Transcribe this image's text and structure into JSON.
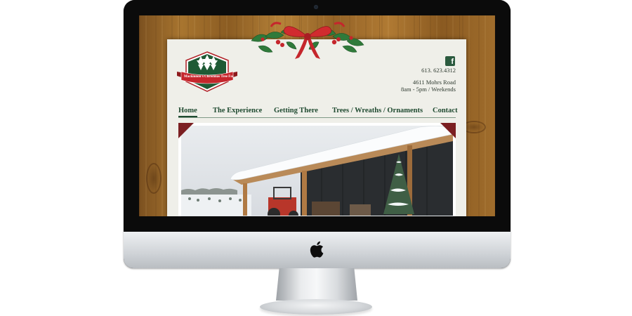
{
  "site": {
    "logo_text": "Mackinnon's Christmas Tree Farm",
    "phone": "613. 623.4312",
    "address": "4611 Mohrs Road",
    "hours": "8am - 5pm / Weekends",
    "social_icon": "facebook-icon"
  },
  "nav": {
    "items": [
      {
        "label": "Home",
        "active": true
      },
      {
        "label": "The Experience"
      },
      {
        "label": "Getting There"
      },
      {
        "label": "Trees / Wreaths / Ornaments"
      },
      {
        "label": "Contact"
      }
    ]
  },
  "colors": {
    "brand_green": "#1f4a30",
    "ribbon_red": "#c5262c",
    "page_bg": "#efefe9"
  }
}
